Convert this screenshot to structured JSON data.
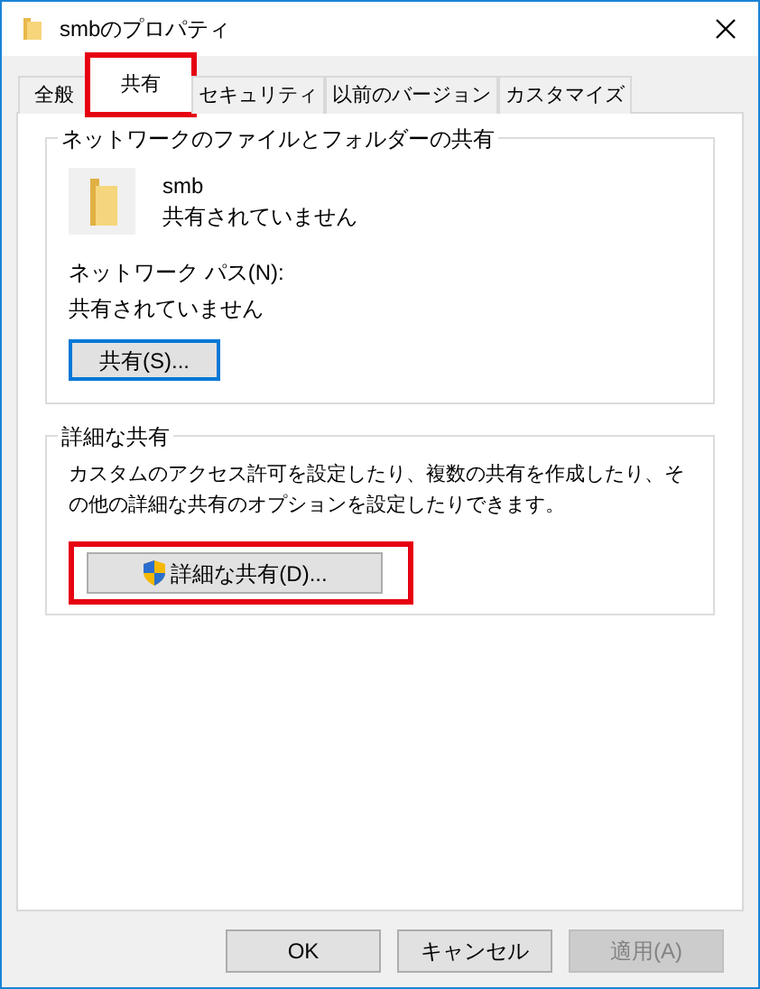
{
  "window": {
    "title": "smbのプロパティ"
  },
  "tabs": [
    {
      "label": "全般",
      "selected": false,
      "highlighted": false
    },
    {
      "label": "共有",
      "selected": true,
      "highlighted": true
    },
    {
      "label": "セキュリティ",
      "selected": false,
      "highlighted": false
    },
    {
      "label": "以前のバージョン",
      "selected": false,
      "highlighted": false
    },
    {
      "label": "カスタマイズ",
      "selected": false,
      "highlighted": false
    }
  ],
  "network_sharing": {
    "title": "ネットワークのファイルとフォルダーの共有",
    "folder_name": "smb",
    "folder_status": "共有されていません",
    "path_label": "ネットワーク パス(N):",
    "path_value": "共有されていません",
    "button": {
      "label": "共有(S)...",
      "focused": true,
      "highlighted": false
    }
  },
  "advanced_sharing": {
    "title": "詳細な共有",
    "description": "カスタムのアクセス許可を設定したり、複数の共有を作成したり、その他の詳細な共有のオプションを設定したりできます。",
    "button": {
      "label": "詳細な共有(D)...",
      "focused": false,
      "highlighted": true
    }
  },
  "buttons": [
    {
      "label": "OK",
      "disabled": false
    },
    {
      "label": "キャンセル",
      "disabled": false
    },
    {
      "label": "適用(A)",
      "disabled": true
    }
  ]
}
